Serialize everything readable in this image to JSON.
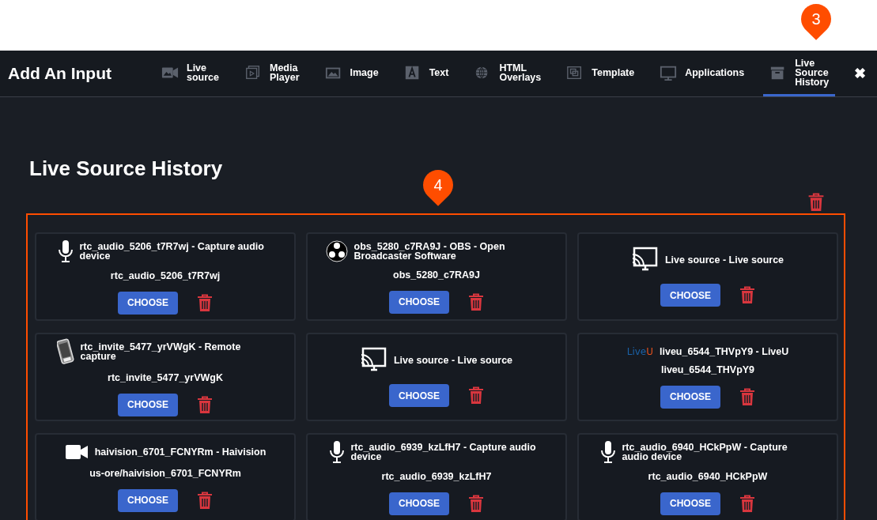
{
  "header": {
    "title": "Add An Input",
    "close": "✖"
  },
  "tabs": [
    {
      "label": "Live source",
      "kind": "camera",
      "selected": false
    },
    {
      "label": "Media Player",
      "kind": "media",
      "selected": false
    },
    {
      "label": "Image",
      "kind": "image",
      "selected": false
    },
    {
      "label": "Text",
      "kind": "text",
      "selected": false
    },
    {
      "label": "HTML Overlays",
      "kind": "globe",
      "selected": false
    },
    {
      "label": "Template",
      "kind": "template",
      "selected": false
    },
    {
      "label": "Applications",
      "kind": "monitor",
      "selected": false
    },
    {
      "label": "Live Source History",
      "kind": "archive",
      "selected": true
    }
  ],
  "page_title": "Live Source History",
  "sources": [
    {
      "kind": "mic",
      "title": "rtc_audio_5206_t7R7wj - Capture audio device",
      "subtitle": "rtc_audio_5206_t7R7wj",
      "button": "CHOOSE"
    },
    {
      "kind": "obs",
      "title": "obs_5280_c7RA9J - OBS - Open Broadcaster Software",
      "subtitle": "obs_5280_c7RA9J",
      "button": "CHOOSE"
    },
    {
      "kind": "cast",
      "title": "Live source - Live source",
      "button": "CHOOSE"
    },
    {
      "kind": "phone",
      "title": "rtc_invite_5477_yrVWgK - Remote capture",
      "subtitle": "rtc_invite_5477_yrVWgK",
      "button": "CHOOSE"
    },
    {
      "kind": "cast",
      "title": "Live source - Live source",
      "button": "CHOOSE"
    },
    {
      "kind": "liveu",
      "logo_text": "LiveU",
      "title": "liveu_6544_THVpY9 - LiveU",
      "subtitle": "liveu_6544_THVpY9",
      "button": "CHOOSE"
    },
    {
      "kind": "camera",
      "title": "haivision_6701_FCNYRm - Haivision",
      "subtitle": "us-ore/haivision_6701_FCNYRm",
      "button": "CHOOSE"
    },
    {
      "kind": "mic",
      "title": "rtc_audio_6939_kzLfH7 - Capture audio device",
      "subtitle": "rtc_audio_6939_kzLfH7",
      "button": "CHOOSE"
    },
    {
      "kind": "mic",
      "title": "rtc_audio_6940_HCkPpW - Capture audio device",
      "subtitle": "rtc_audio_6940_HCkPpW",
      "button": "CHOOSE"
    }
  ],
  "callouts": [
    "3",
    "4"
  ]
}
